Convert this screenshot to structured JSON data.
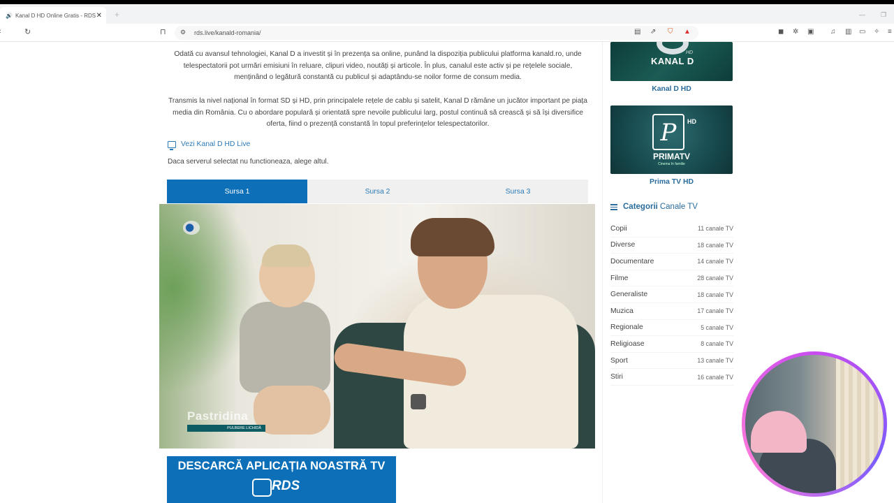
{
  "browser": {
    "tab_title": "Kanal D HD Online Gratis - RDS",
    "url": "rds.live/kanald-romania/"
  },
  "article": {
    "para1": "Odată cu avansul tehnologiei, Kanal D a investit și în prezența sa online, punând la dispoziția publicului platforma kanald.ro, unde telespectatorii pot urmări emisiuni în reluare, clipuri video, noutăți și articole. În plus, canalul este activ și pe rețelele sociale, menținând o legătură constantă cu publicul și adaptându-se noilor forme de consum media.",
    "para2": "Transmis la nivel național în format SD și HD, prin principalele rețele de cablu și satelit, Kanal D rămâne un jucător important pe piața media din România. Cu o abordare populară și orientată spre nevoile publicului larg, postul continuă să crească și să își diversifice oferta, fiind o prezență constantă în topul preferințelor telespectatorilor.",
    "live_link": "Vezi Kanal D HD Live",
    "server_note": "Daca serverul selectat nu functioneaza, alege altul."
  },
  "sources": [
    "Sursa 1",
    "Sursa 2",
    "Sursa 3"
  ],
  "player": {
    "caption": "Pastridina",
    "subcaption": "PULBERE LICHIDĂ"
  },
  "banner": {
    "text": "DESCARCĂ APLICAȚIA NOASTRĂ TV",
    "brand": "RDS"
  },
  "sidebar": {
    "channels": [
      {
        "name": "Kanal D HD",
        "logo": "KANAL D",
        "badge": "HD"
      },
      {
        "name": "Prima TV HD",
        "logo": "PRIMATV",
        "badge": "HD",
        "tagline": "Cinema în familie"
      }
    ],
    "categories_title_bold": "Categorii",
    "categories_title_rest": "Canale TV",
    "categories": [
      {
        "name": "Copii",
        "count": "11 canale TV"
      },
      {
        "name": "Diverse",
        "count": "18 canale TV"
      },
      {
        "name": "Documentare",
        "count": "14 canale TV"
      },
      {
        "name": "Filme",
        "count": "28 canale TV"
      },
      {
        "name": "Generaliste",
        "count": "18 canale TV"
      },
      {
        "name": "Muzica",
        "count": "17 canale TV"
      },
      {
        "name": "Regionale",
        "count": "5 canale TV"
      },
      {
        "name": "Religioase",
        "count": "8 canale TV"
      },
      {
        "name": "Sport",
        "count": "13 canale TV"
      },
      {
        "name": "Stiri",
        "count": "16 canale TV"
      }
    ]
  }
}
